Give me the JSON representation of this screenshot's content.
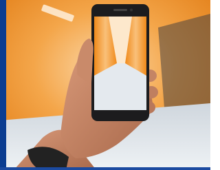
{
  "image": {
    "description_icon": "photo-icon",
    "subject": "hand-holding-smartphone-in-orange-tunnel"
  },
  "colors": {
    "accent_bar": "#0b3d91",
    "bottom_bar": "#1b4aa0",
    "tunnel_orange": "#f0902a",
    "tunnel_light": "#f7c48a",
    "floor": "#e9eef2",
    "skin": "#c98a6a",
    "phone_body": "#1c1c1e",
    "watch_strap": "#222222"
  }
}
